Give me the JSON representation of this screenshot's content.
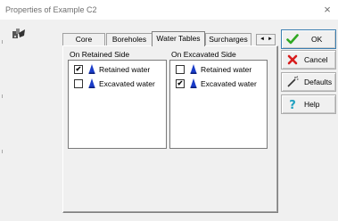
{
  "window": {
    "title": "Properties of Example C2",
    "close_symbol": "×"
  },
  "tabs": [
    {
      "label": "Core",
      "selected": false
    },
    {
      "label": "Boreholes",
      "selected": false
    },
    {
      "label": "Water Tables",
      "selected": true
    },
    {
      "label": "Surcharges",
      "selected": false
    }
  ],
  "tab_scroll": {
    "left": "◄",
    "right": "►"
  },
  "retained_side": {
    "title": "On Retained Side",
    "items": [
      {
        "label": "Retained water",
        "checked": true
      },
      {
        "label": "Excavated water",
        "checked": false
      }
    ]
  },
  "excavated_side": {
    "title": "On Excavated Side",
    "items": [
      {
        "label": "Retained water",
        "checked": false
      },
      {
        "label": "Excavated water",
        "checked": true
      }
    ]
  },
  "buttons": {
    "ok": "OK",
    "cancel": "Cancel",
    "defaults": "Defaults",
    "help": "Help"
  },
  "icons": {
    "app": "properties-icon",
    "water": "water-drop-icon",
    "ok": "check-icon",
    "cancel": "x-icon",
    "defaults": "wand-icon",
    "help": "question-icon"
  },
  "colors": {
    "water_drop": "#1a3cc8",
    "ok_check": "#2fa822",
    "cancel_x": "#d81c1c",
    "help_question": "#1fa0c0"
  }
}
